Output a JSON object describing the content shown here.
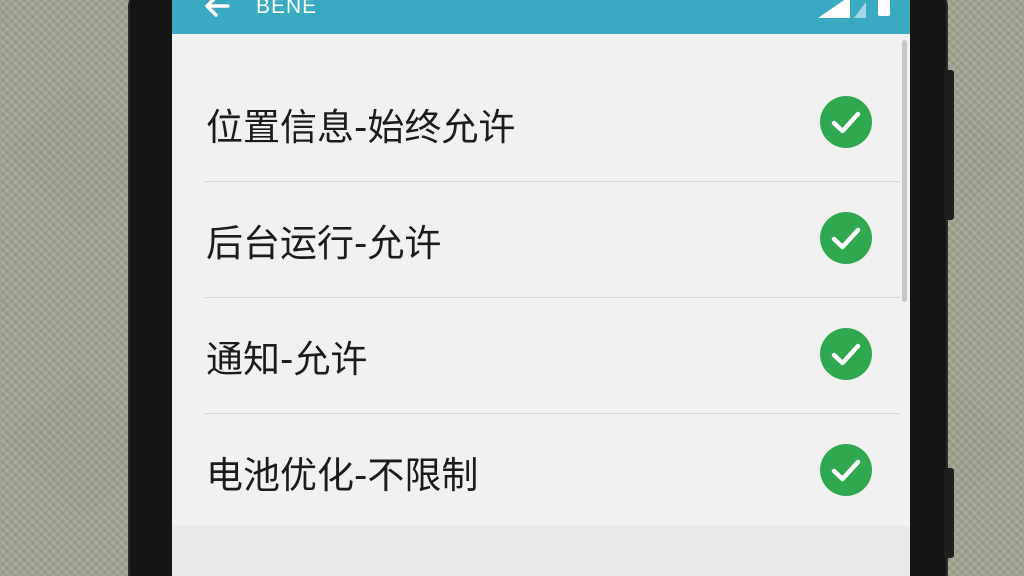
{
  "app_bar": {
    "title": "BENE",
    "back_icon": "back-arrow-icon",
    "color": "#3aa9c2"
  },
  "status_bar": {
    "signal_icon": "signal-icon",
    "battery_icon": "battery-icon"
  },
  "settings": {
    "items": [
      {
        "label": "位置信息-始终允许",
        "checked": true,
        "icon": "check-circle-icon"
      },
      {
        "label": "后台运行-允许",
        "checked": true,
        "icon": "check-circle-icon"
      },
      {
        "label": "通知-允许",
        "checked": true,
        "icon": "check-circle-icon"
      },
      {
        "label": "电池优化-不限制",
        "checked": true,
        "icon": "check-circle-icon"
      }
    ],
    "check_color": "#2fa84f"
  }
}
